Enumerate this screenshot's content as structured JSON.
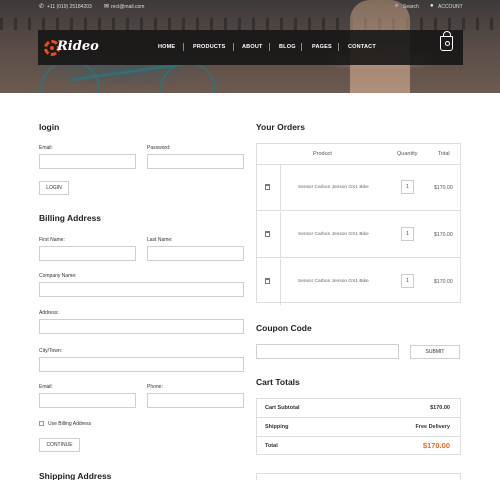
{
  "topbar": {
    "phone": "+11 (019) 25184203",
    "email": "rect@mail.com",
    "search": "Search",
    "account": "ACCOUNT"
  },
  "brand": {
    "logo_text": "Rideo"
  },
  "nav": [
    "HOME",
    "PRODUCTS",
    "ABOUT",
    "BLOG",
    "PAGES",
    "CONTACT"
  ],
  "login": {
    "title": "login",
    "email_label": "Email:",
    "password_label": "Password:",
    "button": "LOGIN"
  },
  "billing": {
    "title": "Billing Address",
    "first_name": "First Name:",
    "last_name": "Last Name:",
    "company": "Company Name:",
    "address": "Address:",
    "city": "City/Town:",
    "email": "Email:",
    "phone": "Phone:",
    "use_billing": "Use Billing Address",
    "button": "CONTINUE"
  },
  "shipping": {
    "title": "Shipping Address"
  },
  "orders": {
    "title": "Your Orders",
    "columns": [
      "Product",
      "Quantity",
      "Total"
    ],
    "rows": [
      {
        "product": "Sensor Carbon Jenson GX1 Bike",
        "qty": "1",
        "total": "$170.00"
      },
      {
        "product": "Sensor Carbon Jenson GX1 Bike",
        "qty": "1",
        "total": "$170.00"
      },
      {
        "product": "Sensor Carbon Jenson GX1 Bike",
        "qty": "1",
        "total": "$170.00"
      }
    ]
  },
  "coupon": {
    "title": "Coupon Code",
    "button": "SUBMIT"
  },
  "cart_totals": {
    "title": "Cart Totals",
    "subtotal_label": "Cart Subtotal",
    "subtotal_value": "$170.00",
    "shipping_label": "Shipping",
    "shipping_value": "Free Delivery",
    "total_label": "Total",
    "total_value": "$170.00"
  },
  "colors": {
    "accent": "#e86b1d",
    "nav_bg": "#141414"
  }
}
